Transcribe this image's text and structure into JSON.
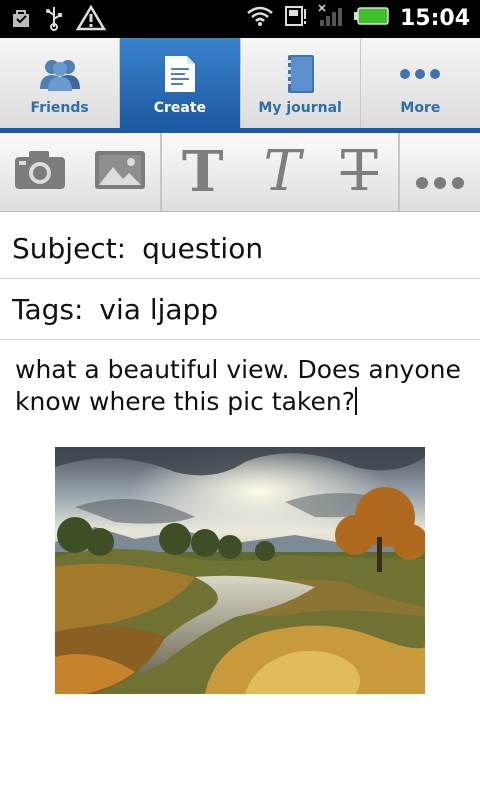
{
  "status": {
    "time": "15:04"
  },
  "tabs": [
    {
      "label": "Friends",
      "icon": "friends-icon",
      "active": false
    },
    {
      "label": "Create",
      "icon": "document-icon",
      "active": true
    },
    {
      "label": "My journal",
      "icon": "notebook-icon",
      "active": false
    },
    {
      "label": "More",
      "icon": "more-icon",
      "active": false
    }
  ],
  "toolbar": {
    "camera": "camera-icon",
    "gallery": "image-icon",
    "bold": "T",
    "italic": "T",
    "strike": "T",
    "more": "more-icon"
  },
  "form": {
    "subject_label": "Subject:",
    "subject_value": "question",
    "tags_label": "Tags:",
    "tags_value": "via ljapp",
    "body": "what a beautiful view. Does anyone know where this pic taken?"
  },
  "colors": {
    "accent": "#1d5aa3",
    "tab_label": "#2f6fa8"
  }
}
